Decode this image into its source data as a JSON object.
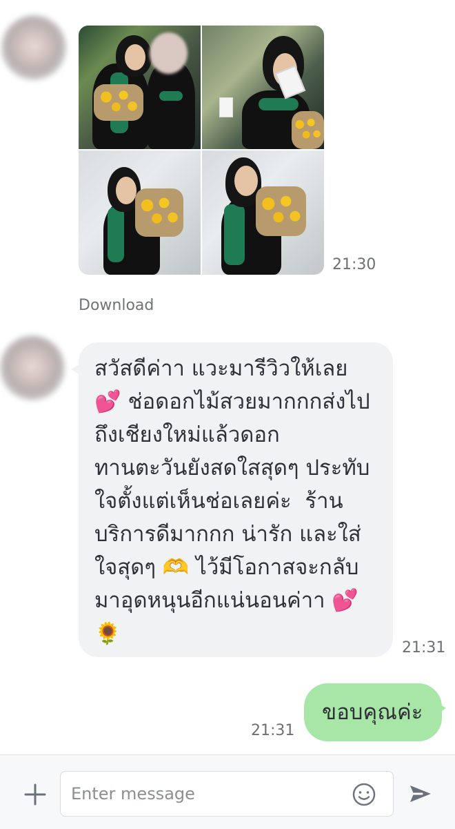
{
  "chat": {
    "photo_timestamp": "21:30",
    "download_label": "Download",
    "incoming_message": "สวัสดีค่าา แวะมารีวิวให้เลย 💕 ช่อดอกไม้สวยมากกกส่งไปถึงเชียงใหม่แล้วดอกทานตะวันยังสดใสสุดๆ ประทับใจตั้งแต่เห็นช่อเลยค่ะ  ร้านบริการดีมากกก น่ารัก และใส่ใจสุดๆ 🫶 ไว้มีโอกาสจะกลับมาอุดหนุนอีกแน่นอนค่าา 💕🌻",
    "incoming_timestamp": "21:31",
    "outgoing_message": "ขอบคุณค่ะ",
    "outgoing_timestamp": "21:31"
  },
  "composer": {
    "placeholder": "Enter message",
    "add_icon": "plus-icon",
    "emoji_icon": "smiley-icon",
    "send_icon": "send-icon"
  },
  "colors": {
    "incoming_bubble": "#f1f2f4",
    "outgoing_bubble": "#a8e6a7",
    "timestamp": "#6c7076",
    "download": "#6f747a"
  }
}
